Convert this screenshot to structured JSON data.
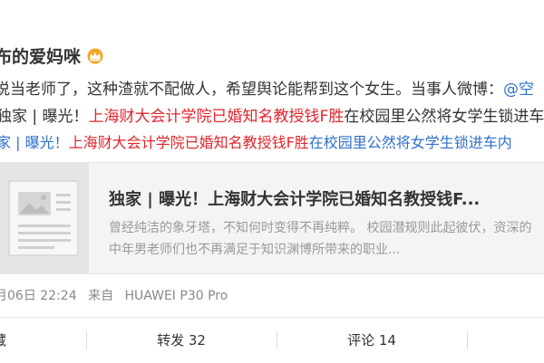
{
  "post": {
    "author": "布的爱妈咪",
    "text_line1": "说当老师了，这种渣就不配做人，希望舆论能帮到这个女生。当事人微博：",
    "mention": "@空",
    "text_line2_prefix": "独家 | 曝光！",
    "text_line2_red": "上海财大会计学院已婚知名教授钱F胜",
    "text_line2_suffix": "在校园里公然将女学生锁进车",
    "text_line3_prefix": "家 | 曝光！",
    "text_line3_red": "上海财大会计学院已婚知名教授钱F胜",
    "text_line3_blue": "在校园里公然将女学生锁进车内"
  },
  "card": {
    "title": "独家 | 曝光！上海财大会计学院已婚知名教授钱F...",
    "description": "曾经纯洁的象牙塔，不知何时变得不再纯粹。 校园潜规则此起彼伏，资深的中年男老师们也不再满足于知识渊博所带来的职业..."
  },
  "meta": {
    "date": "月06日 22:24",
    "source_prefix": "来自",
    "device": "HUAWEI P30 Pro"
  },
  "actions": {
    "favorite_label": "藏",
    "repost_label": "转发 32",
    "comment_label": "评论 14"
  },
  "colors": {
    "link_red": "#e0262d",
    "link_blue": "#2f6fc9",
    "muted": "#999999"
  }
}
